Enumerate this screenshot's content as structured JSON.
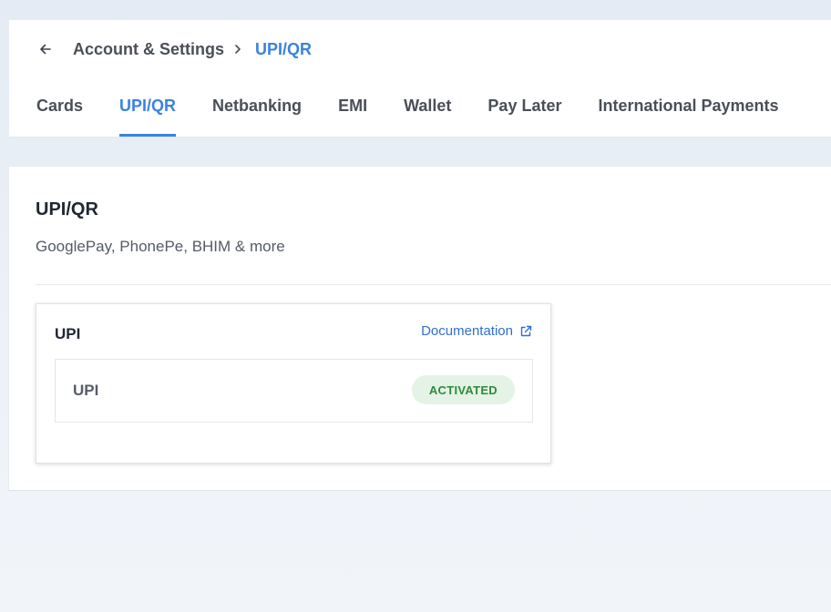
{
  "breadcrumb": {
    "parent": "Account & Settings",
    "current": "UPI/QR"
  },
  "tabs": [
    {
      "label": "Cards",
      "active": false
    },
    {
      "label": "UPI/QR",
      "active": true
    },
    {
      "label": "Netbanking",
      "active": false
    },
    {
      "label": "EMI",
      "active": false
    },
    {
      "label": "Wallet",
      "active": false
    },
    {
      "label": "Pay Later",
      "active": false
    },
    {
      "label": "International Payments",
      "active": false
    }
  ],
  "section": {
    "title": "UPI/QR",
    "subtitle": "GooglePay, PhonePe, BHIM & more"
  },
  "card": {
    "title": "UPI",
    "doc_link_label": "Documentation",
    "method": {
      "name": "UPI",
      "status": "ACTIVATED"
    }
  },
  "colors": {
    "accent": "#3b82e0",
    "link": "#2f6fcf",
    "status_bg": "#e4f3e6",
    "status_text": "#2f8a3c"
  },
  "icons": {
    "back": "arrow-left-icon",
    "separator": "chevron-right-icon",
    "external": "external-link-icon"
  }
}
